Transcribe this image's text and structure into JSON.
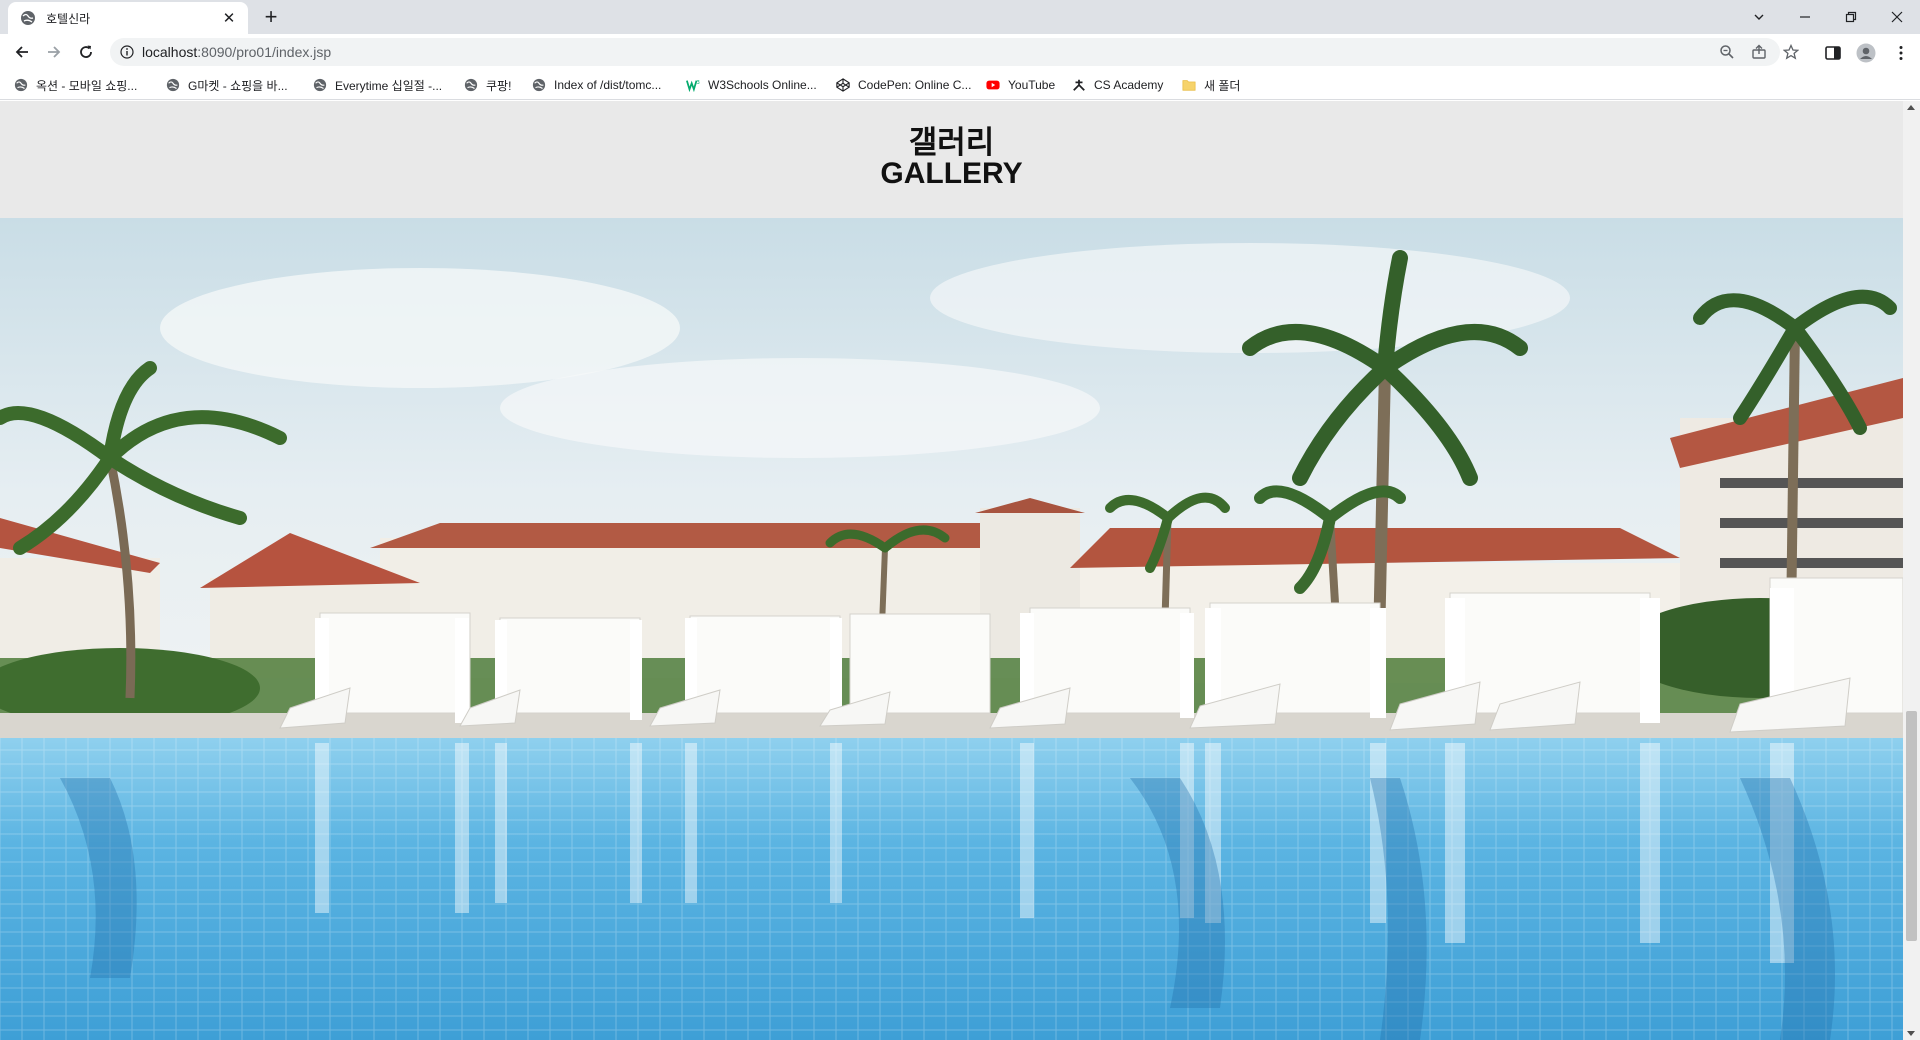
{
  "browser": {
    "tab_title": "호텔신라",
    "new_tab_label": "+",
    "url_host": "localhost",
    "url_rest": ":8090/pro01/index.jsp"
  },
  "bookmarks": [
    {
      "label": "옥션 - 모바일 쇼핑...",
      "icon": "globe-icon"
    },
    {
      "label": "G마켓 - 쇼핑을 바...",
      "icon": "globe-icon"
    },
    {
      "label": "Everytime 십일절 -...",
      "icon": "globe-icon"
    },
    {
      "label": "쿠팡!",
      "icon": "globe-icon"
    },
    {
      "label": "Index of /dist/tomc...",
      "icon": "globe-icon"
    },
    {
      "label": "W3Schools Online...",
      "icon": "w3schools-icon"
    },
    {
      "label": "CodePen: Online C...",
      "icon": "codepen-icon"
    },
    {
      "label": "YouTube",
      "icon": "youtube-icon"
    },
    {
      "label": "CS Academy",
      "icon": "cs-academy-icon"
    },
    {
      "label": "새 폴더",
      "icon": "folder-icon"
    }
  ],
  "page": {
    "heading_ko": "갤러리",
    "heading_en": "GALLERY"
  },
  "colors": {
    "page_bg": "#e9e9e9",
    "sky": "#dce9ee",
    "pool": "#59b3e0",
    "roof": "#b6533f",
    "building": "#f2efe8"
  }
}
